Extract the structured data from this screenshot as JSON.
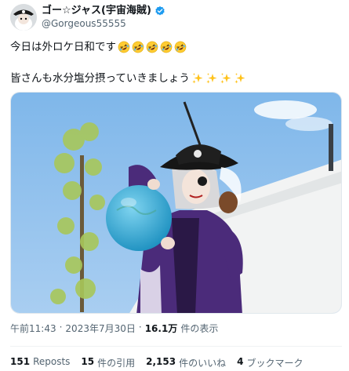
{
  "author": {
    "display_name": "ゴー☆ジャス(宇宙海賊)",
    "handle": "@Gorgeous55555",
    "verified": true
  },
  "tweet": {
    "line1_text": "今日は外ロケ日和です",
    "line1_emoji": "rolling-on-the-floor-laughing",
    "line1_emoji_count": 5,
    "line2_text": "皆さんも水分塩分摂っていきましょう",
    "line2_emoji": "sparkles",
    "line2_emoji_count": 4
  },
  "meta": {
    "time": "午前11:43",
    "separator": "·",
    "date": "2023年7月30日",
    "views_count": "16.1万",
    "views_label": "件の表示"
  },
  "stats": {
    "reposts_count": "151",
    "reposts_label": "Reposts",
    "quotes_count": "15",
    "quotes_label": "件の引用",
    "likes_count": "2,153",
    "likes_label": "件のいいね",
    "bookmarks_count": "4",
    "bookmarks_label": "ブックマーク"
  },
  "colors": {
    "verified_blue": "#1d9bf0",
    "text_primary": "#0f1419",
    "text_secondary": "#536471"
  }
}
